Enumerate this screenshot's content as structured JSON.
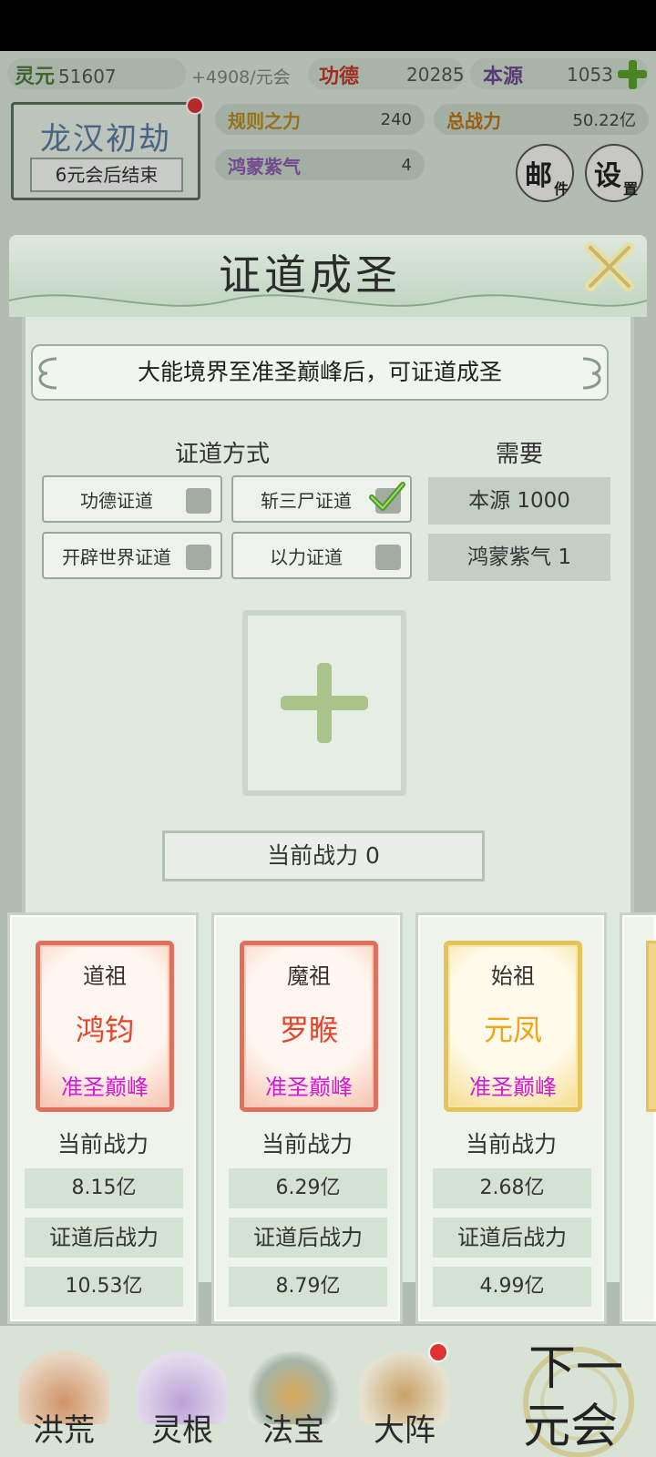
{
  "colors": {
    "accent_green": "#8fb067",
    "name_red": "#e4432c",
    "name_gold": "#f0a418",
    "realm_purple": "#d21ad4"
  },
  "top_bar": {
    "lingyuan_label": "灵元",
    "lingyuan_value": "51607",
    "rate": "+4908/元会",
    "gongde_label": "功德",
    "gongde_value": "20285",
    "benyuan_label": "本源",
    "benyuan_value": "1053",
    "plus_icon": "plus-icon"
  },
  "jie": {
    "title": "龙汉初劫",
    "subtitle": "6元会后结束"
  },
  "stats": {
    "rule_label": "规则之力",
    "rule_value": "240",
    "total_label": "总战力",
    "total_value": "50.22亿",
    "hongmeng_label": "鸿蒙紫气",
    "hongmeng_value": "4"
  },
  "mail_button": {
    "big": "邮",
    "small": "件"
  },
  "settings_button": {
    "big": "设",
    "small": "置"
  },
  "modal": {
    "title": "证道成圣",
    "banner": "大能境界至准圣巅峰后，可证道成圣",
    "method_header": "证道方式",
    "need_header": "需要",
    "methods": [
      {
        "label": "功德证道",
        "checked": false
      },
      {
        "label": "斩三尸证道",
        "checked": true
      },
      {
        "label": "开辟世界证道",
        "checked": false
      },
      {
        "label": "以力证道",
        "checked": false
      }
    ],
    "needs": [
      "本源 1000",
      "鸿蒙紫气 1"
    ],
    "current_power_label": "当前战力  0"
  },
  "cards": [
    {
      "title": "道祖",
      "name": "鸿钧",
      "realm": "准圣巅峰",
      "cur_label": "当前战力",
      "cur_value": "8.15亿",
      "after_label": "证道后战力",
      "after_value": "10.53亿",
      "frame": "red"
    },
    {
      "title": "魔祖",
      "name": "罗睺",
      "realm": "准圣巅峰",
      "cur_label": "当前战力",
      "cur_value": "6.29亿",
      "after_label": "证道后战力",
      "after_value": "8.79亿",
      "frame": "red"
    },
    {
      "title": "始祖",
      "name": "元凤",
      "realm": "准圣巅峰",
      "cur_label": "当前战力",
      "cur_value": "2.68亿",
      "after_label": "证道后战力",
      "after_value": "4.99亿",
      "frame": "gold"
    }
  ],
  "bottom_nav": {
    "items": [
      "洪荒",
      "灵根",
      "法宝",
      "大阵"
    ],
    "next_line1": "下一",
    "next_line2": "元会"
  }
}
